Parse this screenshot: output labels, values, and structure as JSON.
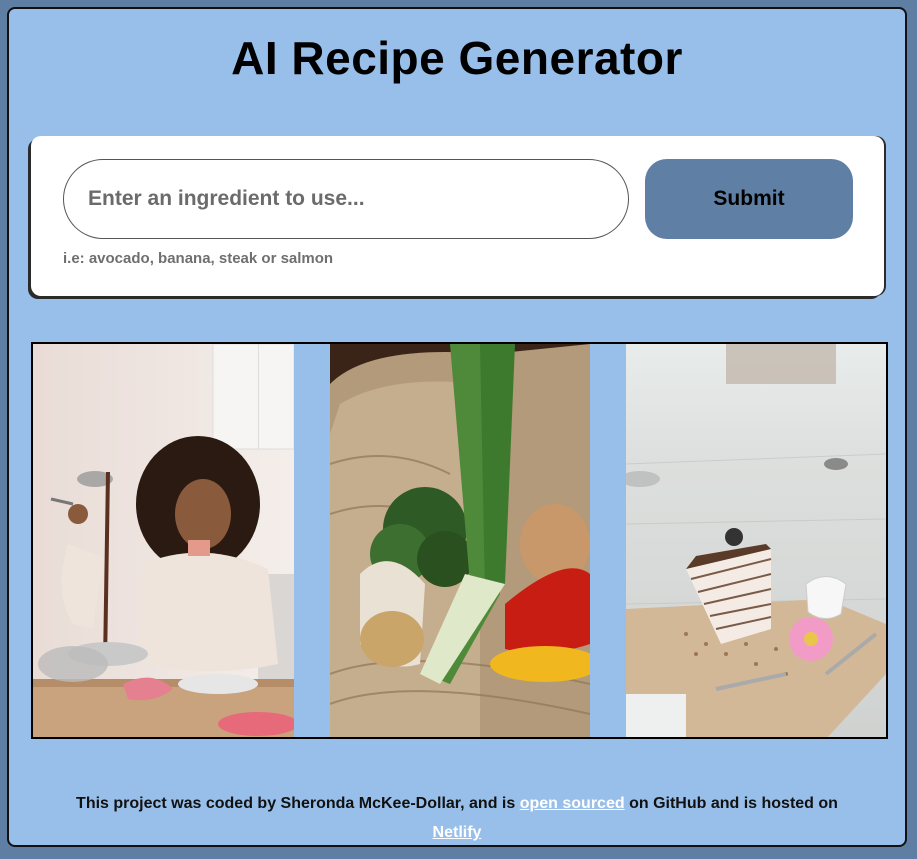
{
  "header": {
    "title": "AI Recipe Generator"
  },
  "form": {
    "placeholder": "Enter an ingredient to use...",
    "submit_label": "Submit",
    "hint": "i.e: avocado, banana, steak or salmon"
  },
  "gallery": {
    "photos": [
      {
        "icon": "woman-baking-chocolate-photo"
      },
      {
        "icon": "vegetable-basket-photo"
      },
      {
        "icon": "crepe-cake-slice-photo"
      }
    ]
  },
  "footer": {
    "text_before": "This project was coded by Sheronda McKee-Dollar, and is ",
    "open_sourced_link": "open sourced",
    "text_middle": " on GitHub and is hosted on ",
    "netlify_link": "Netlify"
  },
  "colors": {
    "page_frame": "#5e7ea3",
    "background": "#97bfea",
    "button": "#5f7fa4",
    "card": "#ffffff"
  }
}
